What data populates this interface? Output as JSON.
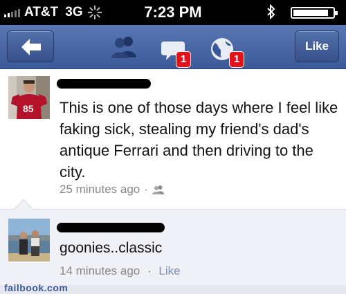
{
  "status_bar": {
    "carrier": "AT&T",
    "network": "3G",
    "time": "7:23 PM"
  },
  "nav": {
    "like_label": "Like",
    "messages_badge": "1",
    "notifications_badge": "1"
  },
  "post": {
    "text": "This is one of those days where I feel like faking sick, stealing my friend's dad's antique Ferrari and then driving to the city.",
    "timestamp": "25 minutes ago",
    "separator": "·",
    "privacy_icon": "friends-icon",
    "avatar_jersey_number": "85"
  },
  "comment": {
    "text": "goonies..classic",
    "timestamp": "14 minutes ago",
    "separator": "·",
    "like_label": "Like"
  },
  "watermark": "failbook.com",
  "colors": {
    "facebook_blue": "#3b5998",
    "badge_red": "#e4121a",
    "meta_gray": "#888888",
    "comment_bg": "#eff1f6"
  }
}
